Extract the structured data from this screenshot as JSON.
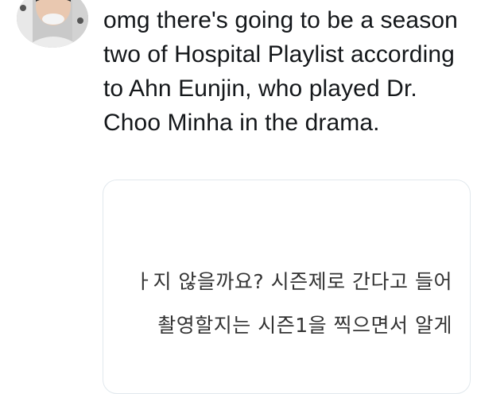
{
  "tweet": {
    "avatar_icon": "user-avatar",
    "text": "omg there's going to be a season two of Hospital Playlist according to Ahn Eunjin, who played Dr. Choo Minha in the drama."
  },
  "media": {
    "subtitle_line1": "ㅏ지 않을까요? 시즌제로 간다고 들어",
    "subtitle_line2": "촬영할지는 시즌1을 찍으면서 알게"
  }
}
